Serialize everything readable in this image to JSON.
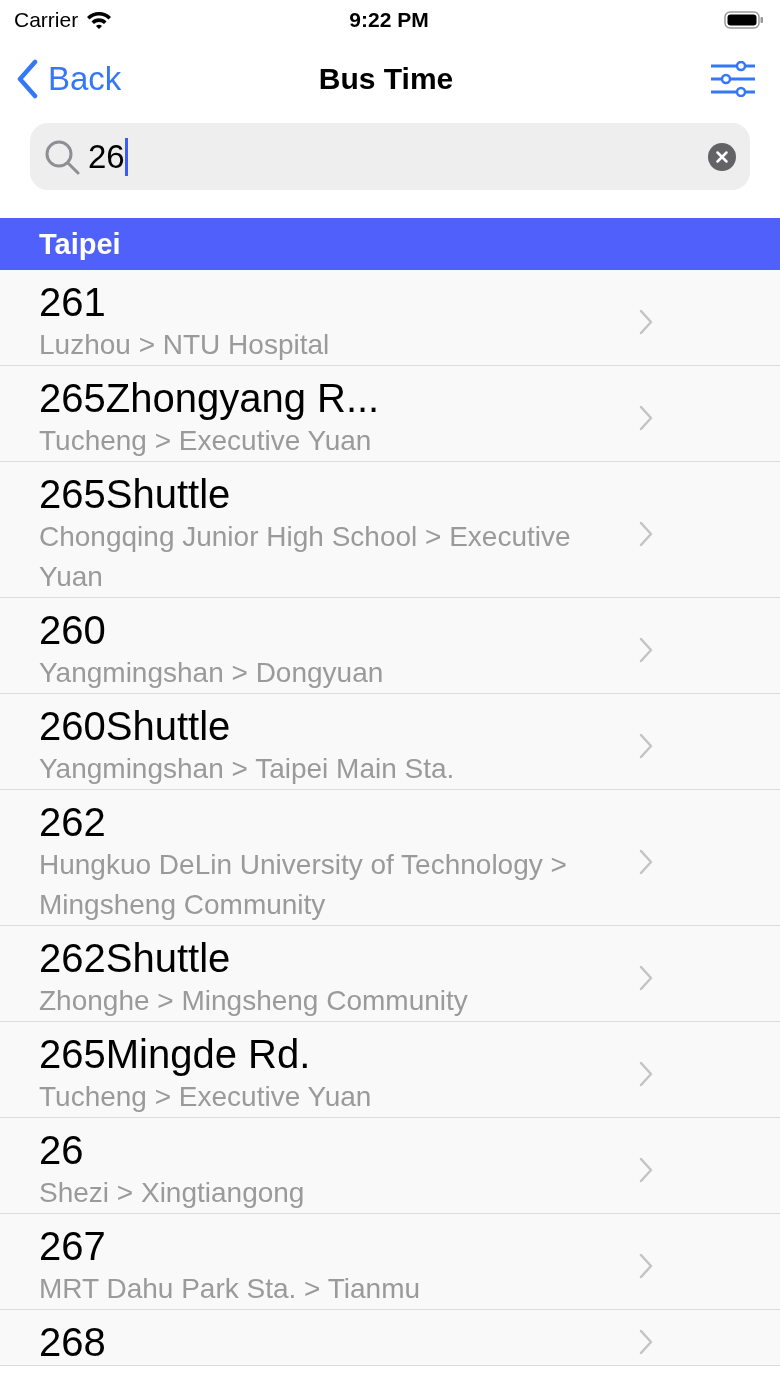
{
  "status_bar": {
    "carrier": "Carrier",
    "time": "9:22 PM"
  },
  "nav": {
    "back": "Back",
    "title": "Bus Time"
  },
  "search": {
    "value": "26"
  },
  "section": {
    "title": "Taipei"
  },
  "routes": [
    {
      "name": "261",
      "path": "Luzhou > NTU Hospital"
    },
    {
      "name": "265Zhongyang R...",
      "path": "Tucheng > Executive Yuan"
    },
    {
      "name": "265Shuttle",
      "path": "Chongqing Junior High School > Executive Yuan"
    },
    {
      "name": "260",
      "path": "Yangmingshan > Dongyuan"
    },
    {
      "name": "260Shuttle",
      "path": "Yangmingshan > Taipei Main Sta."
    },
    {
      "name": "262",
      "path": "Hungkuo DeLin University of Technology > Mingsheng Community"
    },
    {
      "name": "262Shuttle",
      "path": "Zhonghe > Mingsheng Community"
    },
    {
      "name": "265Mingde Rd.",
      "path": "Tucheng > Executive Yuan"
    },
    {
      "name": "26",
      "path": "Shezi > Xingtiangong"
    },
    {
      "name": "267",
      "path": "MRT Dahu Park Sta. > Tianmu"
    },
    {
      "name": "268"
    }
  ]
}
